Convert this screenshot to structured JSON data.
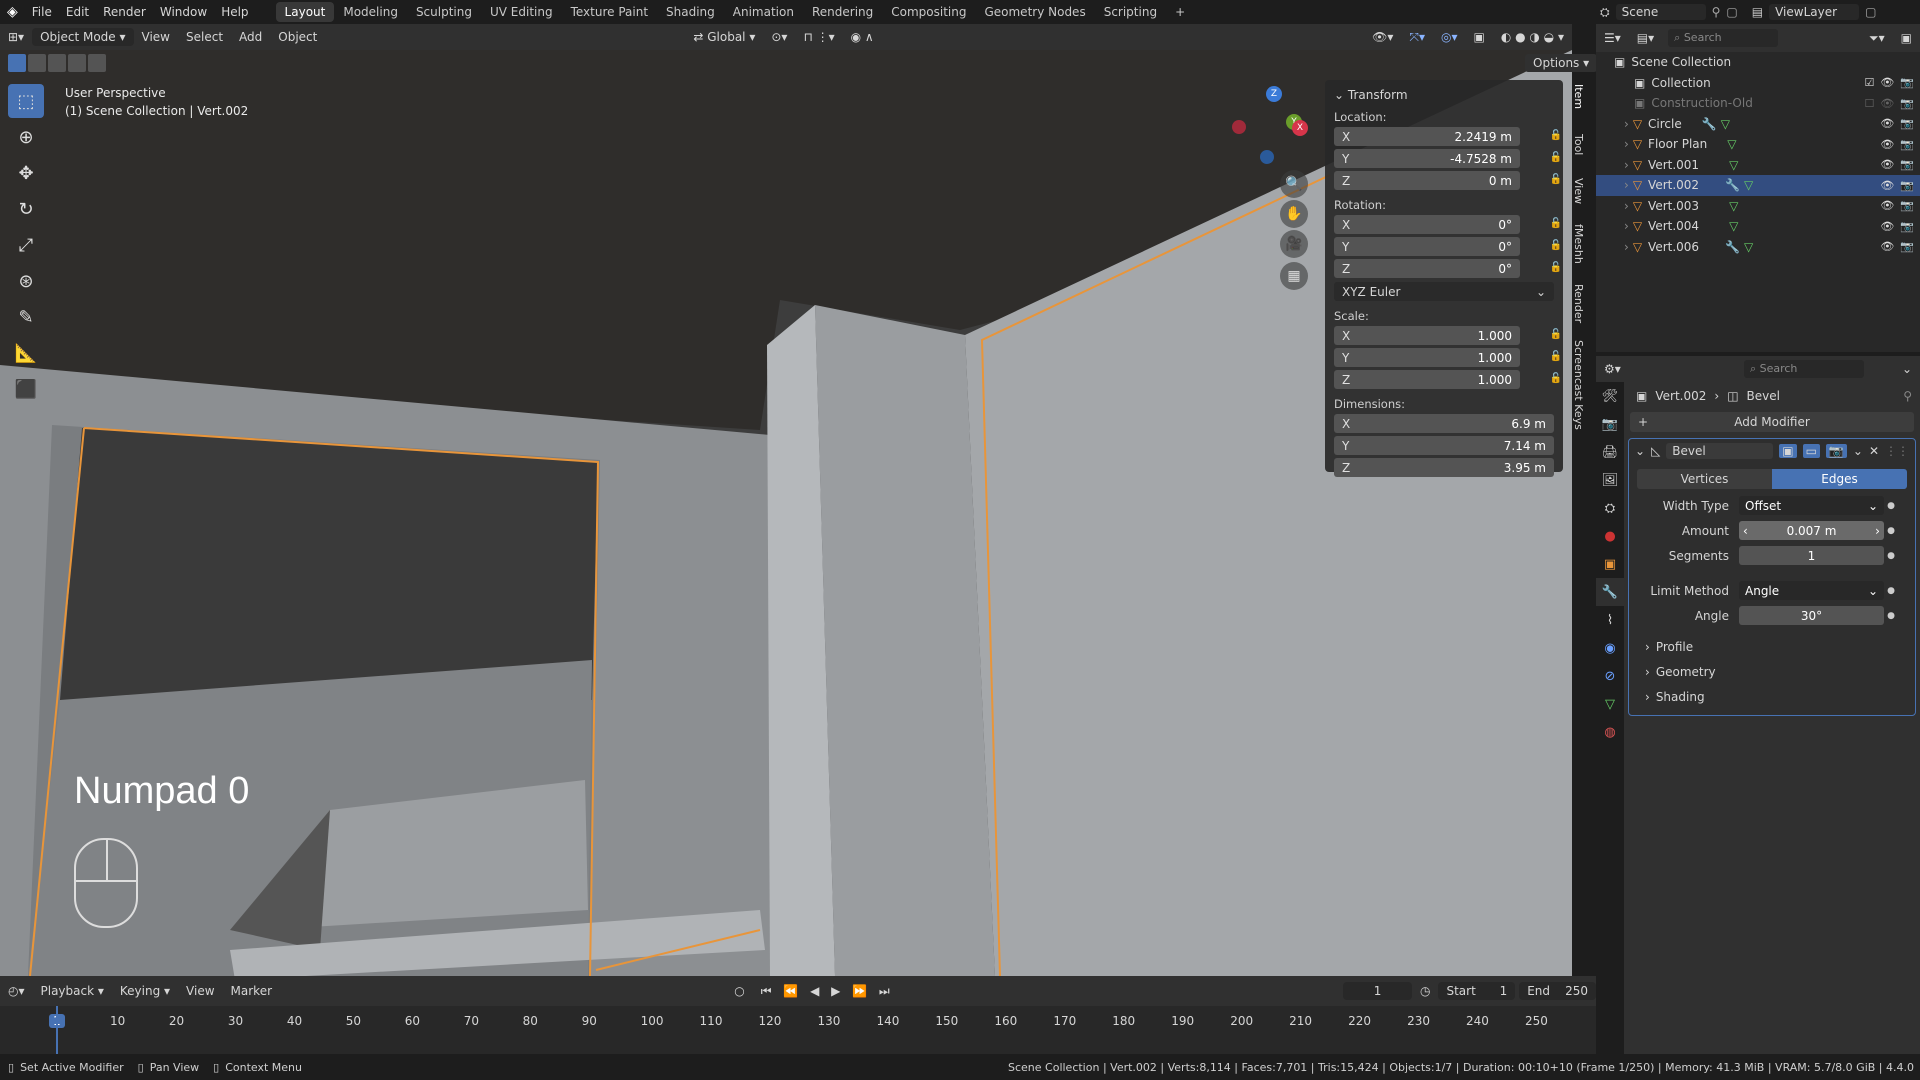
{
  "menu": {
    "items": [
      "File",
      "Edit",
      "Render",
      "Window",
      "Help"
    ],
    "workspaces": [
      "Layout",
      "Modeling",
      "Sculpting",
      "UV Editing",
      "Texture Paint",
      "Shading",
      "Animation",
      "Rendering",
      "Compositing",
      "Geometry Nodes",
      "Scripting"
    ],
    "active_workspace": "Layout",
    "scene": "Scene",
    "view_layer": "ViewLayer"
  },
  "viewport_header": {
    "mode": "Object Mode",
    "menus": [
      "View",
      "Select",
      "Add",
      "Object"
    ],
    "transform_orientation": "Global",
    "options": "Options"
  },
  "viewport": {
    "perspective": "User Perspective",
    "context": "(1) Scene Collection | Vert.002",
    "screencast_key": "Numpad 0",
    "gizmo_axes": [
      "X",
      "Y",
      "Z"
    ]
  },
  "npanel": {
    "title": "Transform",
    "location_label": "Location:",
    "location": {
      "x": "2.2419 m",
      "y": "-4.7528 m",
      "z": "0 m"
    },
    "rotation_label": "Rotation:",
    "rotation": {
      "x": "0°",
      "y": "0°",
      "z": "0°"
    },
    "rotation_mode": "XYZ Euler",
    "scale_label": "Scale:",
    "scale": {
      "x": "1.000",
      "y": "1.000",
      "z": "1.000"
    },
    "dimensions_label": "Dimensions:",
    "dimensions": {
      "x": "6.9 m",
      "y": "7.14 m",
      "z": "3.95 m"
    },
    "axis": {
      "x": "X",
      "y": "Y",
      "z": "Z"
    },
    "side_tabs": [
      "Item",
      "Tool",
      "View",
      "fMeshh",
      "Render",
      "Screencast Keys"
    ]
  },
  "outliner": {
    "search_placeholder": "Search",
    "root": "Scene Collection",
    "rows": [
      {
        "name": "Collection",
        "indent": 1
      },
      {
        "name": "Construction-Old",
        "indent": 1
      },
      {
        "name": "Circle",
        "indent": 2
      },
      {
        "name": "Floor Plan",
        "indent": 2
      },
      {
        "name": "Vert.001",
        "indent": 2
      },
      {
        "name": "Vert.002",
        "indent": 2,
        "selected": true
      },
      {
        "name": "Vert.003",
        "indent": 2
      },
      {
        "name": "Vert.004",
        "indent": 2
      },
      {
        "name": "Vert.006",
        "indent": 2
      }
    ]
  },
  "properties": {
    "search_placeholder": "Search",
    "breadcrumb_object": "Vert.002",
    "breadcrumb_modifier": "Bevel",
    "add_modifier": "Add Modifier",
    "modifier_name": "Bevel",
    "tab_vertices": "Vertices",
    "tab_edges": "Edges",
    "width_type_label": "Width Type",
    "width_type": "Offset",
    "amount_label": "Amount",
    "amount": "0.007 m",
    "segments_label": "Segments",
    "segments": "1",
    "limit_method_label": "Limit Method",
    "limit_method": "Angle",
    "angle_label": "Angle",
    "angle": "30°",
    "subpanels": [
      "Profile",
      "Geometry",
      "Shading"
    ]
  },
  "timeline": {
    "menus": [
      "Playback",
      "Keying",
      "View",
      "Marker"
    ],
    "current_frame": "1",
    "start_label": "Start",
    "start": "1",
    "end_label": "End",
    "end": "250",
    "ticks": [
      "1",
      "10",
      "20",
      "30",
      "40",
      "50",
      "60",
      "70",
      "80",
      "90",
      "100",
      "110",
      "120",
      "130",
      "140",
      "150",
      "160",
      "170",
      "180",
      "190",
      "200",
      "210",
      "220",
      "230",
      "240",
      "250"
    ]
  },
  "statusbar": {
    "hints": [
      "Set Active Modifier",
      "Pan View",
      "Context Menu"
    ],
    "info": "Scene Collection | Vert.002 | Verts:8,114 | Faces:7,701 | Tris:15,424 | Objects:1/7 | Duration: 00:10+10 (Frame 1/250) | Memory: 41.3 MiB | VRAM: 5.7/8.0 GiB | 4.4.0"
  },
  "colors": {
    "accent": "#4772b3",
    "selection_outline": "#e8953a",
    "header_bg": "#303030",
    "viewport_bg": "#3d3d3d"
  }
}
